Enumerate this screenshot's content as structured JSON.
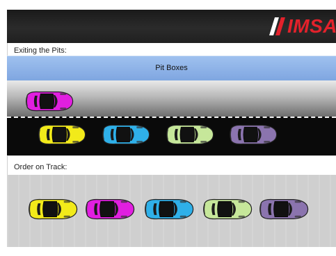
{
  "header": {
    "logo_text": "IMSA",
    "logo_color": "#e3212b"
  },
  "exit_section": {
    "label": "Exiting the Pits:",
    "pit_boxes_label": "Pit Boxes",
    "pit_car": {
      "color": "magenta",
      "fill": "#e11fe0"
    },
    "lane_cars": [
      {
        "color": "yellow",
        "fill": "#f2ea1a"
      },
      {
        "color": "cyan",
        "fill": "#2fb0e9"
      },
      {
        "color": "light-green",
        "fill": "#c6e79a"
      },
      {
        "color": "purple",
        "fill": "#8b74ae"
      }
    ]
  },
  "order_section": {
    "label": "Order on Track:",
    "cars": [
      {
        "color": "yellow",
        "fill": "#f2ea1a"
      },
      {
        "color": "magenta",
        "fill": "#e11fe0"
      },
      {
        "color": "cyan",
        "fill": "#2fb0e9"
      },
      {
        "color": "light-green",
        "fill": "#c6e79a"
      },
      {
        "color": "purple",
        "fill": "#8b74ae"
      }
    ]
  }
}
